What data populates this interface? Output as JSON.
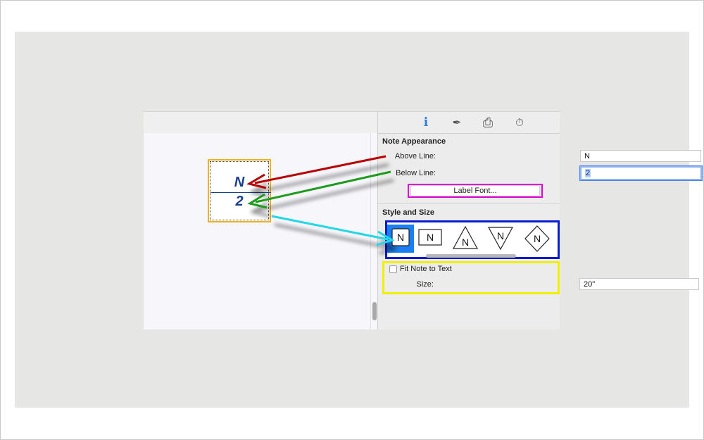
{
  "inspector": {
    "tabs": [
      {
        "name": "info-icon",
        "glyph": "i"
      },
      {
        "name": "pen-icon",
        "glyph": "✒"
      },
      {
        "name": "printer-icon",
        "glyph": "⎙"
      },
      {
        "name": "timer-icon",
        "glyph": "⏱"
      }
    ],
    "note_appearance": {
      "title": "Note Appearance",
      "above_line_label": "Above Line:",
      "above_line_value": "N",
      "below_line_label": "Below Line:",
      "below_line_value": "2",
      "label_font_button": "Label Font..."
    },
    "style_and_size": {
      "title": "Style and Size",
      "styles": [
        {
          "name": "style-square-selected",
          "glyph": "N",
          "selected": true
        },
        {
          "name": "style-square",
          "glyph": "N"
        },
        {
          "name": "style-triangle-up",
          "glyph": "N"
        },
        {
          "name": "style-triangle-down",
          "glyph": "N"
        },
        {
          "name": "style-diamond",
          "glyph": "N"
        }
      ],
      "fit_note_label": "Fit Note to Text",
      "fit_note_checked": false,
      "size_label": "Size:",
      "size_value": "20\""
    }
  },
  "note": {
    "above": "N",
    "below": "2"
  },
  "colors": {
    "arrow_red": "#b80000",
    "arrow_green": "#1d9b1d",
    "arrow_cyan": "#22d8e8",
    "highlight_magenta": "#e000d6",
    "highlight_blue": "#0b1ad4",
    "highlight_yellow": "#f0f000",
    "note_border": "#f2b21e",
    "note_text": "#1b3e8c"
  }
}
